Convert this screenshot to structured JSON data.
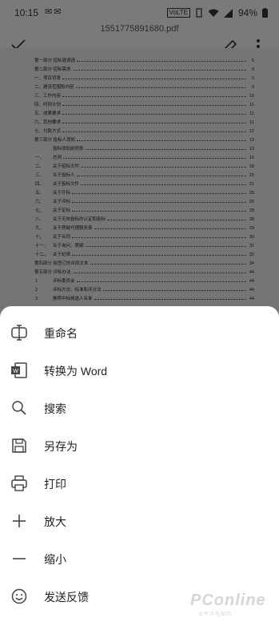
{
  "status": {
    "time": "10:15",
    "left_icons": "✉✉",
    "volte": "VoLTE",
    "battery": "94%"
  },
  "appbar": {
    "title": "1551775891680.pdf"
  },
  "toc": [
    {
      "num": "",
      "text": "第一部分  招标邀请函",
      "page": "5"
    },
    {
      "num": "",
      "text": "第二部分  招标需求",
      "page": "9"
    },
    {
      "num": "",
      "text": "一、项目背景",
      "page": "9"
    },
    {
      "num": "",
      "text": "二、建设范围和内容",
      "page": "9"
    },
    {
      "num": "",
      "text": "三、工作内容",
      "page": "10"
    },
    {
      "num": "",
      "text": "四、时间计划",
      "page": "11"
    },
    {
      "num": "",
      "text": "五、成果要求",
      "page": "11"
    },
    {
      "num": "",
      "text": "六、其他要求",
      "page": "11"
    },
    {
      "num": "",
      "text": "七、付款方式",
      "page": "12"
    },
    {
      "num": "",
      "text": "第三部分  投标人须知",
      "page": "13"
    },
    {
      "num": "",
      "text": "投标须知前附表",
      "page": "13",
      "sub": true
    },
    {
      "num": "一、",
      "text": "总则",
      "page": "16",
      "sub": true
    },
    {
      "num": "二、",
      "text": "关于招标文件",
      "page": "18",
      "sub": true
    },
    {
      "num": "三、",
      "text": "关于投标人",
      "page": "20",
      "sub": true
    },
    {
      "num": "四、",
      "text": "关于投标文件",
      "page": "21",
      "sub": true
    },
    {
      "num": "五、",
      "text": "关于开标",
      "page": "25",
      "sub": true
    },
    {
      "num": "六、",
      "text": "关于评标",
      "page": "26",
      "sub": true
    },
    {
      "num": "七、",
      "text": "关于定标",
      "page": "28",
      "sub": true
    },
    {
      "num": "八、",
      "text": "关于无效投标的认定和废标",
      "page": "28",
      "sub": true
    },
    {
      "num": "九、",
      "text": "关于质疑代理服务费",
      "page": "29",
      "sub": true
    },
    {
      "num": "十、",
      "text": "关于合同",
      "page": "30",
      "sub": true
    },
    {
      "num": "十一、",
      "text": "关于询问、质疑",
      "page": "31",
      "sub": true
    },
    {
      "num": "十二、",
      "text": "关于纪律",
      "page": "32",
      "sub": true
    },
    {
      "num": "",
      "text": "第四部分  拟签订的合同文本",
      "page": "34"
    },
    {
      "num": "",
      "text": "第五部分  评标办法",
      "page": "44"
    },
    {
      "num": "1",
      "text": "评标委员会",
      "page": "44",
      "sub": true
    },
    {
      "num": "2",
      "text": "评标方法、标准和评分法",
      "page": "44",
      "sub": true
    },
    {
      "num": "3",
      "text": "推荐中标候选人名单",
      "page": "44",
      "sub": true
    }
  ],
  "menu": [
    {
      "label": "重命名",
      "icon": "rename-icon"
    },
    {
      "label": "转换为 Word",
      "icon": "word-icon"
    },
    {
      "label": "搜索",
      "icon": "search-icon"
    },
    {
      "label": "另存为",
      "icon": "save-icon"
    },
    {
      "label": "打印",
      "icon": "print-icon"
    },
    {
      "label": "放大",
      "icon": "zoom-in-icon"
    },
    {
      "label": "缩小",
      "icon": "zoom-out-icon"
    },
    {
      "label": "发送反馈",
      "icon": "feedback-icon"
    }
  ],
  "watermark": {
    "text": "PConline",
    "sub": "太平洋电脑网"
  }
}
